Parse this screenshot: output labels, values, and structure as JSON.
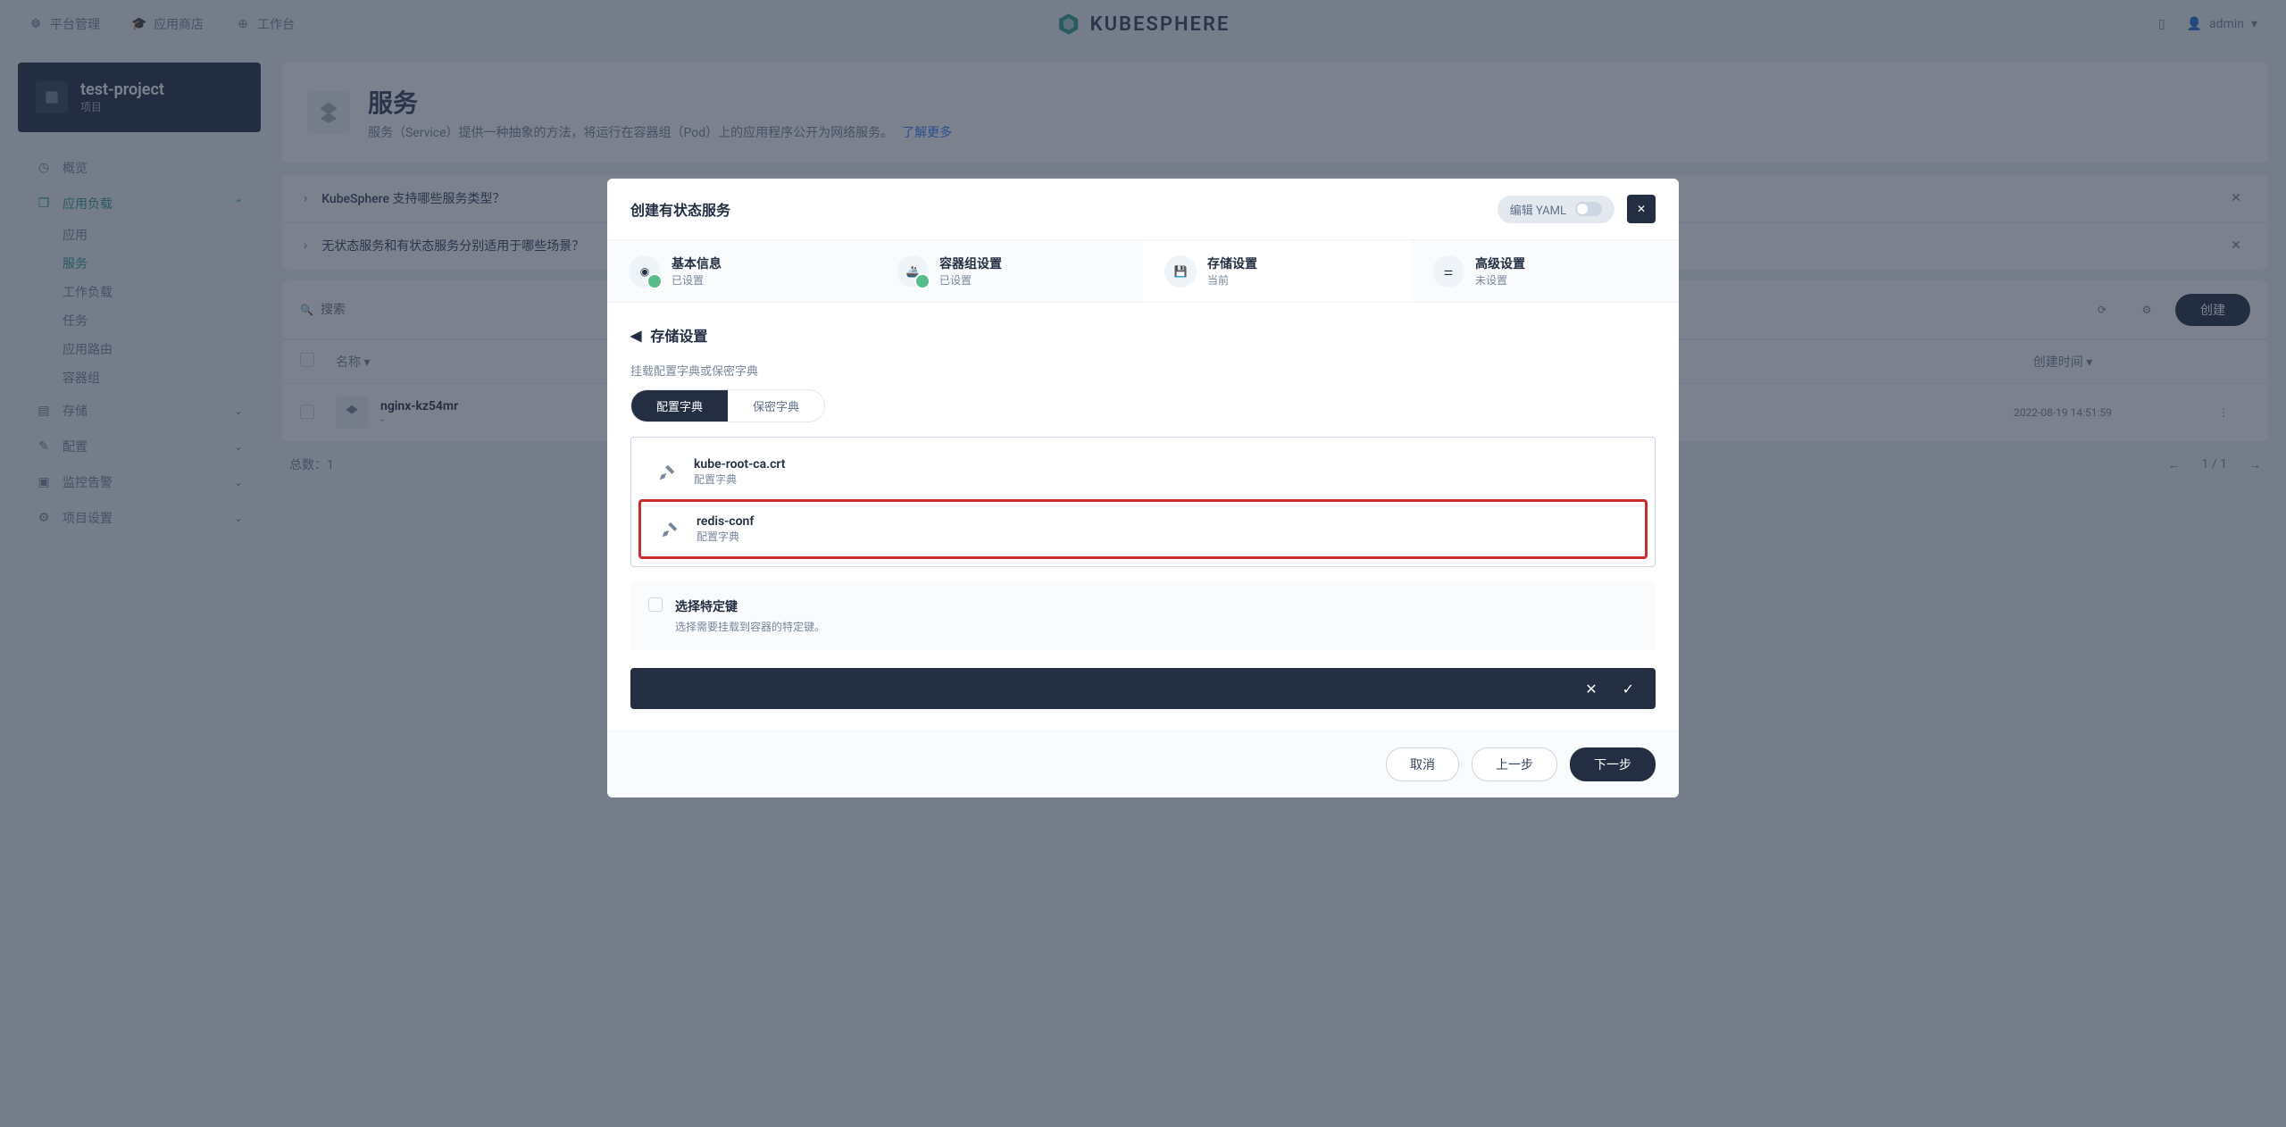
{
  "topbar": {
    "platform": "平台管理",
    "appstore": "应用商店",
    "workspace": "工作台",
    "logo": "KUBESPHERE",
    "user": "admin"
  },
  "sidebar": {
    "project": {
      "name": "test-project",
      "sub": "项目"
    },
    "overview": "概览",
    "workloads_group": "应用负载",
    "subs": {
      "app": "应用",
      "service": "服务",
      "workload": "工作负载",
      "job": "任务",
      "ingress": "应用路由",
      "pod": "容器组"
    },
    "storage": "存储",
    "config": "配置",
    "monitor": "监控告警",
    "settings": "项目设置"
  },
  "page": {
    "title": "服务",
    "desc": "服务（Service）提供一种抽象的方法，将运行在容器组（Pod）上的应用程序公开为网络服务。",
    "more": "了解更多"
  },
  "faq": [
    {
      "q": "KubeSphere 支持哪些服务类型？"
    },
    {
      "q": "无状态服务和有状态服务分别适用于哪些场景？"
    }
  ],
  "toolbar": {
    "search": "搜索",
    "create": "创建"
  },
  "table": {
    "headers": {
      "name": "名称",
      "time": "创建时间"
    },
    "rows": [
      {
        "name": "nginx-kz54mr",
        "sub": "-",
        "time": "2022-08-19 14:51:59"
      }
    ],
    "total": "总数：1",
    "page": "1 / 1"
  },
  "modal": {
    "title": "创建有状态服务",
    "yaml": "编辑 YAML",
    "steps": [
      {
        "t": "基本信息",
        "s": "已设置"
      },
      {
        "t": "容器组设置",
        "s": "已设置"
      },
      {
        "t": "存储设置",
        "s": "当前"
      },
      {
        "t": "高级设置",
        "s": "未设置"
      }
    ],
    "body_title": "存储设置",
    "mount_label": "挂载配置字典或保密字典",
    "pills": {
      "config": "配置字典",
      "secret": "保密字典"
    },
    "items": [
      {
        "name": "kube-root-ca.crt",
        "sub": "配置字典"
      },
      {
        "name": "redis-conf",
        "sub": "配置字典"
      }
    ],
    "keys": {
      "t": "选择特定键",
      "s": "选择需要挂载到容器的特定键。"
    },
    "footer": {
      "cancel": "取消",
      "prev": "上一步",
      "next": "下一步"
    }
  }
}
